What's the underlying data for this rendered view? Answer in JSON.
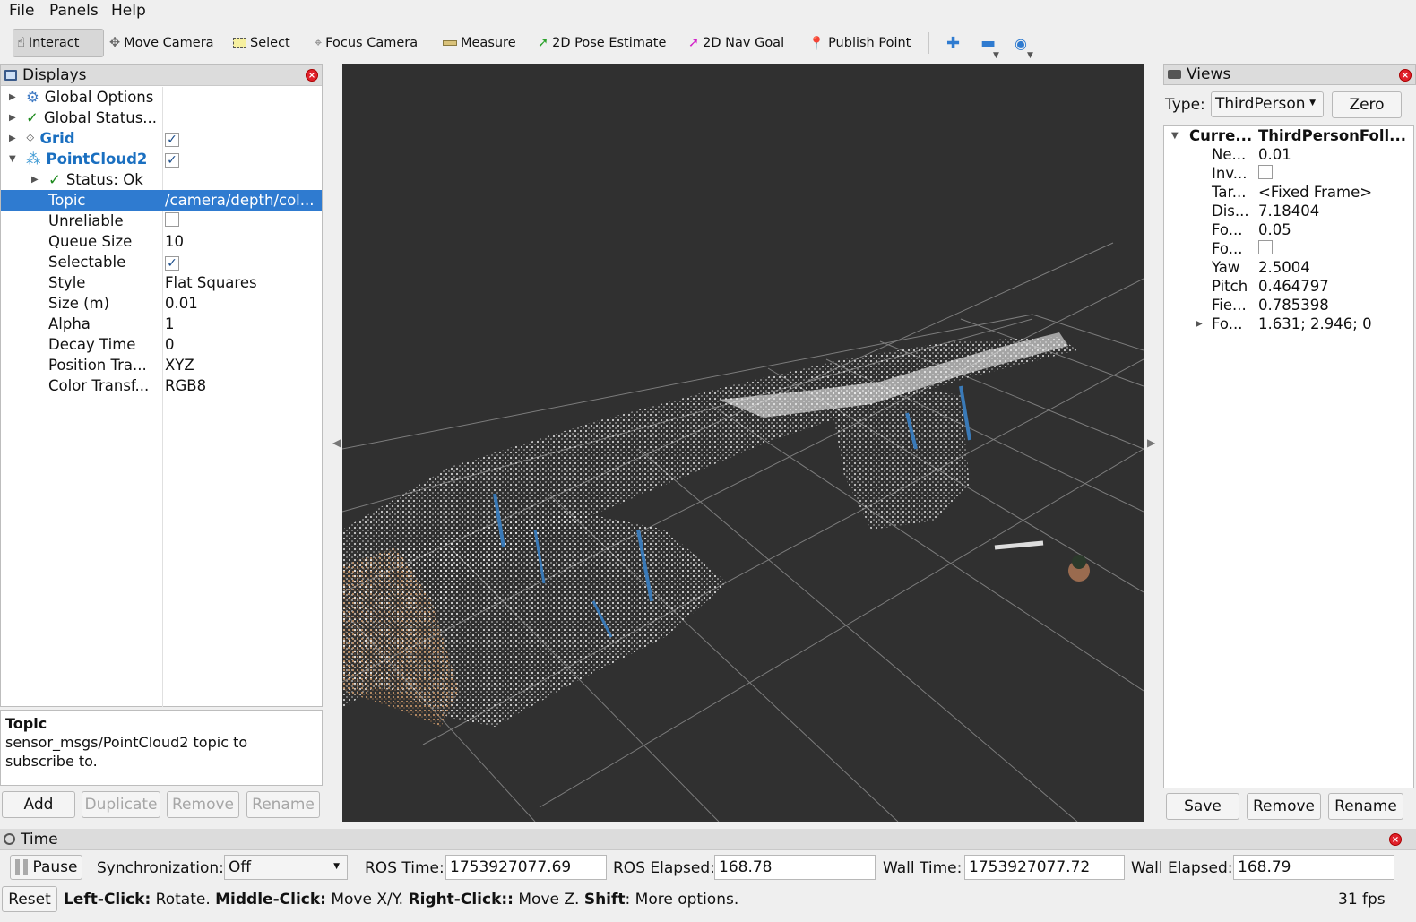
{
  "menu": {
    "file": "File",
    "panels": "Panels",
    "help": "Help"
  },
  "toolbar": {
    "interact": "Interact",
    "move_camera": "Move Camera",
    "select": "Select",
    "focus_camera": "Focus Camera",
    "measure": "Measure",
    "pose_estimate": "2D Pose Estimate",
    "nav_goal": "2D Nav Goal",
    "publish_point": "Publish Point"
  },
  "displays": {
    "title": "Displays",
    "rows": [
      {
        "label": "Global Options",
        "value": ""
      },
      {
        "label": "Global Status...",
        "value": ""
      },
      {
        "label": "Grid",
        "value": "",
        "checked": true
      },
      {
        "label": "PointCloud2",
        "value": "",
        "checked": true
      },
      {
        "label": "Status: Ok",
        "value": ""
      },
      {
        "label": "Topic",
        "value": "/camera/depth/col..."
      },
      {
        "label": "Unreliable",
        "value": "",
        "checked": false
      },
      {
        "label": "Queue Size",
        "value": "10"
      },
      {
        "label": "Selectable",
        "value": "",
        "checked": true
      },
      {
        "label": "Style",
        "value": "Flat Squares"
      },
      {
        "label": "Size (m)",
        "value": "0.01"
      },
      {
        "label": "Alpha",
        "value": "1"
      },
      {
        "label": "Decay Time",
        "value": "0"
      },
      {
        "label": "Position Tra...",
        "value": "XYZ"
      },
      {
        "label": "Color Transf...",
        "value": "RGB8"
      }
    ],
    "help_title": "Topic",
    "help_text": "sensor_msgs/PointCloud2 topic to subscribe to.",
    "buttons": {
      "add": "Add",
      "duplicate": "Duplicate",
      "remove": "Remove",
      "rename": "Rename"
    }
  },
  "views": {
    "title": "Views",
    "type_label": "Type:",
    "type_value": "ThirdPerson",
    "zero": "Zero",
    "current_key": "Curre...",
    "current_value": "ThirdPersonFoll...",
    "props": [
      {
        "k": "Ne...",
        "v": "0.01"
      },
      {
        "k": "Inv...",
        "v": "",
        "checkbox": true
      },
      {
        "k": "Tar...",
        "v": "<Fixed Frame>"
      },
      {
        "k": "Dis...",
        "v": "7.18404"
      },
      {
        "k": "Fo...",
        "v": "0.05"
      },
      {
        "k": "Fo...",
        "v": "",
        "checkbox": true
      },
      {
        "k": "Yaw",
        "v": "2.5004"
      },
      {
        "k": "Pitch",
        "v": "0.464797"
      },
      {
        "k": "Fie...",
        "v": "0.785398"
      },
      {
        "k": "Fo...",
        "v": "1.631; 2.946; 0"
      }
    ],
    "buttons": {
      "save": "Save",
      "remove": "Remove",
      "rename": "Rename"
    }
  },
  "time": {
    "title": "Time",
    "pause": "Pause",
    "sync_label": "Synchronization:",
    "sync_value": "Off",
    "ros_time_label": "ROS Time:",
    "ros_time": "1753927077.69",
    "ros_elapsed_label": "ROS Elapsed:",
    "ros_elapsed": "168.78",
    "wall_time_label": "Wall Time:",
    "wall_time": "1753927077.72",
    "wall_elapsed_label": "Wall Elapsed:",
    "wall_elapsed": "168.79"
  },
  "status": {
    "reset": "Reset",
    "left_click": "Left-Click:",
    "left_action": " Rotate. ",
    "middle_click": "Middle-Click:",
    "middle_action": " Move X/Y. ",
    "right_click": "Right-Click::",
    "right_action": " Move Z. ",
    "shift": "Shift",
    "shift_action": ": More options.",
    "fps": "31 fps"
  },
  "colors": {
    "selection": "#2f7bd0",
    "viewport_bg": "#303030",
    "link_blue": "#1a6fc0",
    "close_red": "#e0202a"
  }
}
